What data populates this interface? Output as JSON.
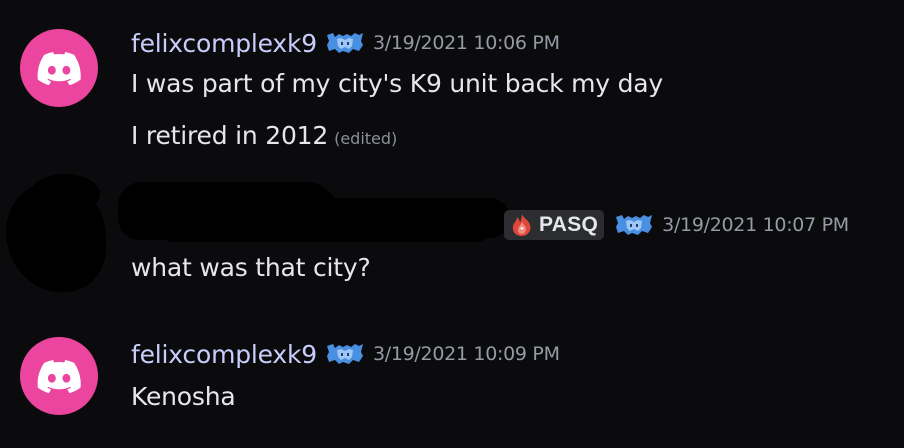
{
  "messages": [
    {
      "username": "felixcomplexk9",
      "clan_icon": "clan-badge-icon",
      "timestamp": "3/19/2021 10:06 PM",
      "avatar_icon": "discord-logo-icon",
      "avatar_color": "#eb459f",
      "lines": [
        "I was part of my city's K9 unit back my day",
        "I retired in 2012"
      ],
      "edited_label": "(edited)"
    },
    {
      "username": "",
      "tag_label": "PASQ",
      "tag_icon": "flame-icon",
      "clan_icon": "clan-badge-icon",
      "timestamp": "3/19/2021 10:07 PM",
      "lines": [
        "what was that city?"
      ]
    },
    {
      "username": "felixcomplexk9",
      "clan_icon": "clan-badge-icon",
      "timestamp": "3/19/2021 10:09 PM",
      "avatar_icon": "discord-logo-icon",
      "avatar_color": "#eb459f",
      "lines": [
        "Kenosha"
      ]
    }
  ],
  "colors": {
    "background": "#0b0b0d",
    "username": "#c9cdfb",
    "timestamp": "#949ba4",
    "text": "#e6e7ea",
    "clan_badge": "#4a90e2"
  }
}
